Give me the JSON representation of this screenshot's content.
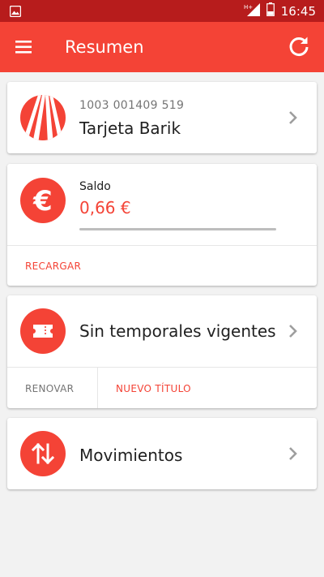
{
  "status_bar": {
    "network": "H+",
    "time": "16:45"
  },
  "app_bar": {
    "title": "Resumen",
    "menu_icon": "hamburger-menu-icon",
    "refresh_icon": "refresh-icon"
  },
  "card": {
    "number": "1003 001409 519",
    "name": "Tarjeta Barik"
  },
  "balance": {
    "label": "Saldo",
    "amount": "0,66 €",
    "progress_fraction": 0.0,
    "action_label": "RECARGAR"
  },
  "passes": {
    "title": "Sin temporales vigentes",
    "renew_label": "RENOVAR",
    "new_label": "NUEVO TÍTULO"
  },
  "movements": {
    "title": "Movimientos"
  },
  "colors": {
    "accent": "#f44336",
    "status_bar": "#b71c1c",
    "background": "#f2f2f2"
  }
}
